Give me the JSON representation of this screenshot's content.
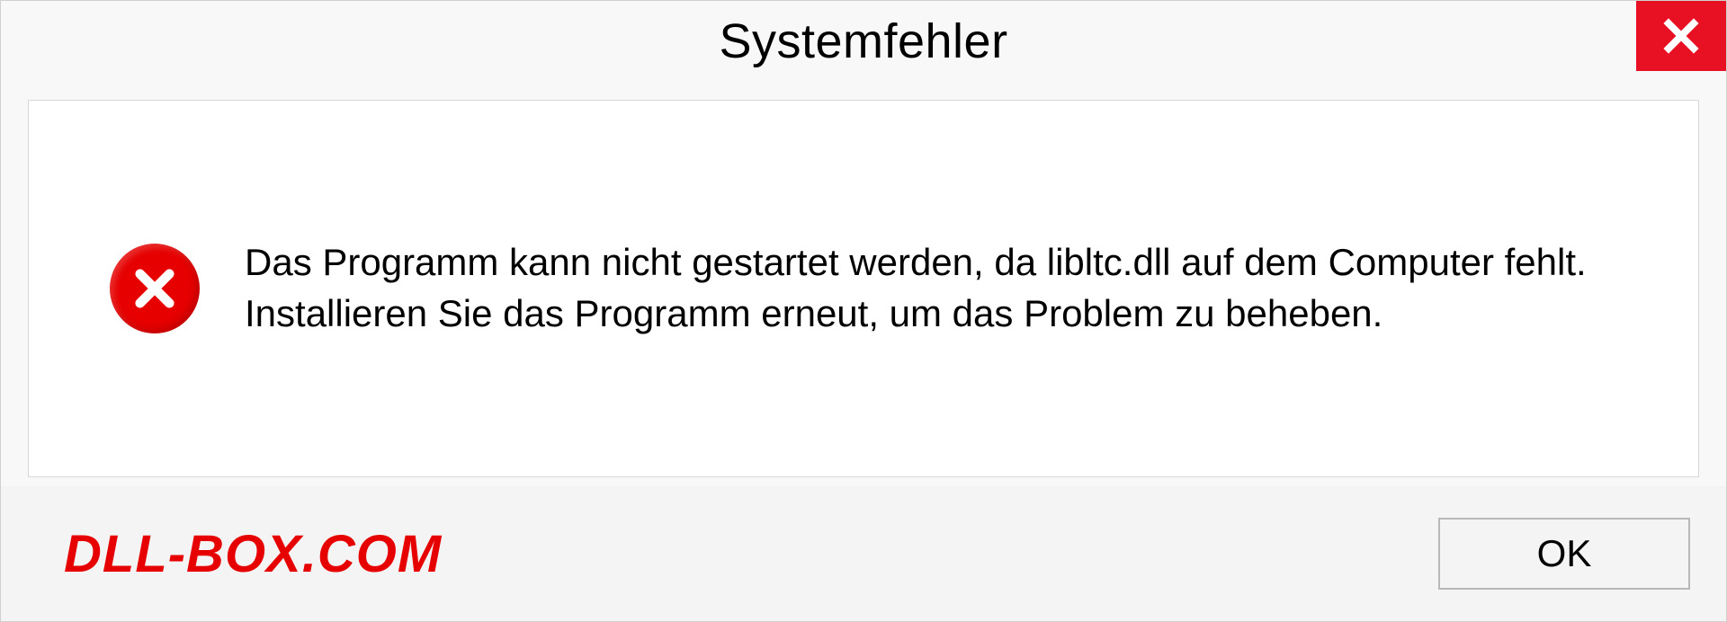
{
  "dialog": {
    "title": "Systemfehler",
    "message": "Das Programm kann nicht gestartet werden, da libltc.dll auf dem Computer fehlt. Installieren Sie das Programm erneut, um das Problem zu beheben.",
    "ok_label": "OK"
  },
  "watermark": "DLL-BOX.COM",
  "colors": {
    "close_bg": "#e81123",
    "error_red": "#e60000",
    "frame_bg": "#f8f8f8",
    "content_bg": "#ffffff"
  }
}
